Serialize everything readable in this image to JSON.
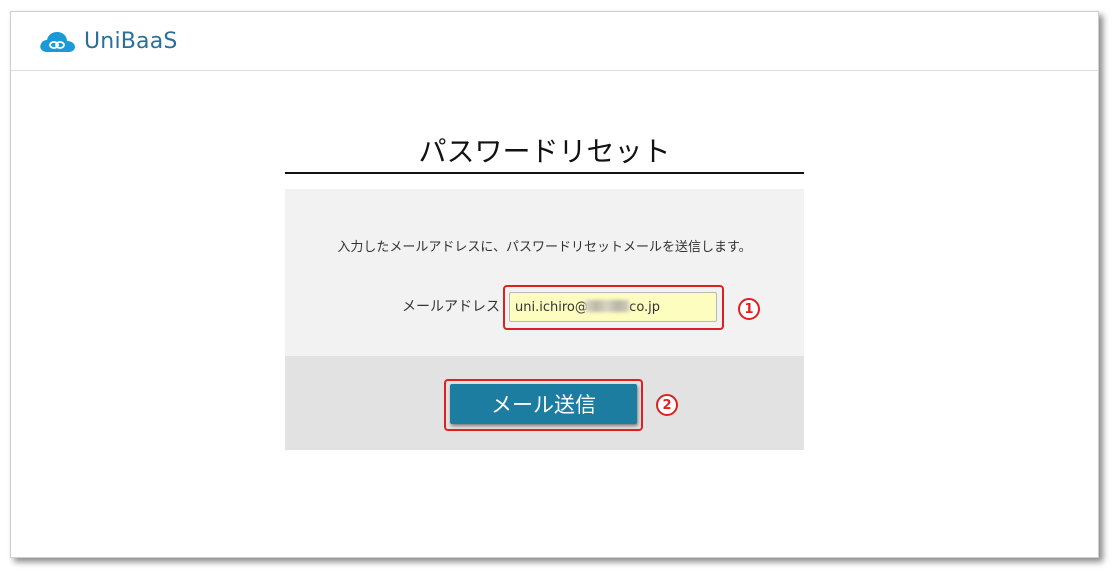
{
  "header": {
    "logo_text": "UniBaaS",
    "logo_icon": "cloud-link-icon",
    "brand_color": "#1a9ad6"
  },
  "main": {
    "title": "パスワードリセット",
    "description": "入力したメールアドレスに、パスワードリセットメールを送信します。",
    "email_label": "メールアドレス",
    "email_value": "uni.ichiro@          co.jp",
    "submit_label": "メール送信"
  },
  "annotations": {
    "marker_1": "1",
    "marker_2": "2",
    "highlight_color": "#e02020"
  }
}
